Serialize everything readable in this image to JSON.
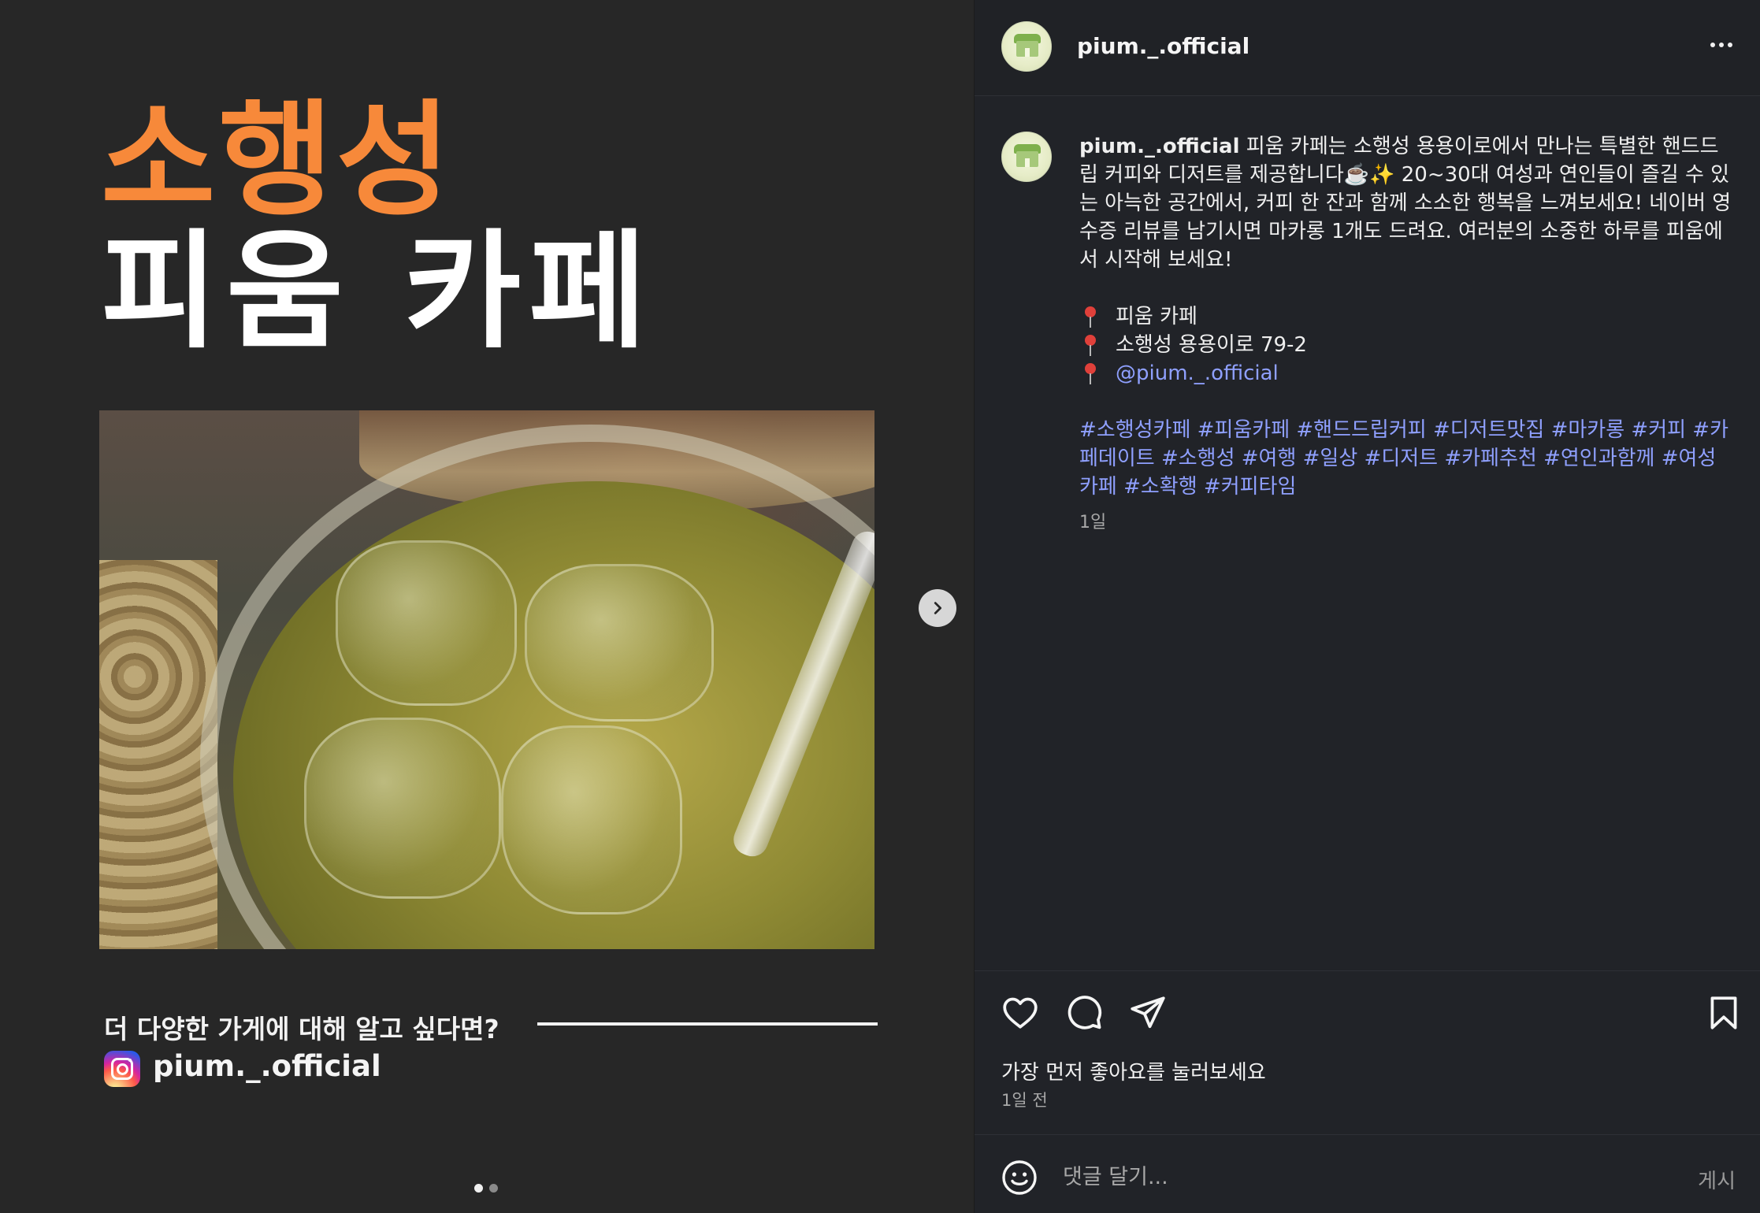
{
  "post_media": {
    "title_line1": "소행성",
    "title_line2": "피움 카페",
    "cta_text": "더 다양한 가게에 대해 알고 싶다면?",
    "cta_handle": "pium._.official",
    "slide_count": 2,
    "active_slide": 1
  },
  "sidebar": {
    "header": {
      "username": "pium._.official"
    },
    "caption": {
      "username": "pium._.official",
      "text": "피움 카페는 소행성 용용이로에서 만나는 특별한 핸드드립 커피와 디저트를 제공합니다☕️✨ 20~30대 여성과 연인들이 즐길 수 있는 아늑한 공간에서, 커피 한 잔과 함께 소소한 행복을 느껴보세요! 네이버 영수증 리뷰를 남기시면 마카롱 1개도 드려요. 여러분의 소중한 하루를 피움에서 시작해 보세요!",
      "meta": {
        "place": "피움 카페",
        "address": "소행성 용용이로 79-2",
        "mention": "@pium._.official"
      },
      "hashtags": "#소행성카페 #피움카페 #핸드드립커피 #디저트맛집 #마카롱 #커피 #카페데이트 #소행성 #여행 #일상 #디저트 #카페추천 #연인과함께 #여성카페 #소확행 #커피타임",
      "time_ago": "1일"
    },
    "likes_text": "가장 먼저 좋아요를 눌러보세요",
    "post_time": "1일 전",
    "comment": {
      "placeholder": "댓글 달기...",
      "post_label": "게시"
    }
  },
  "colors": {
    "title_accent": "#f7893a",
    "link": "#8fa0ff",
    "sidebar_bg": "#212328",
    "media_bg": "#272727"
  }
}
